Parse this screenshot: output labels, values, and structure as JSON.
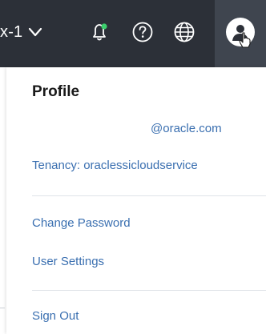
{
  "topbar": {
    "region_label": "x-1",
    "icons": [
      "chevron-down-icon",
      "bell-icon",
      "help-icon",
      "globe-icon",
      "user-avatar-icon"
    ],
    "colors": {
      "bar_bg": "#2c3038",
      "avatar_bg": "#3f454f",
      "notification_dot": "#3ccf6d"
    }
  },
  "profile_menu": {
    "title": "Profile",
    "email": "@oracle.com",
    "tenancy": "Tenancy: oraclessicloudservice",
    "links": {
      "change_password": "Change Password",
      "user_settings": "User Settings",
      "sign_out": "Sign Out"
    },
    "link_color": "#3a6fb0"
  }
}
